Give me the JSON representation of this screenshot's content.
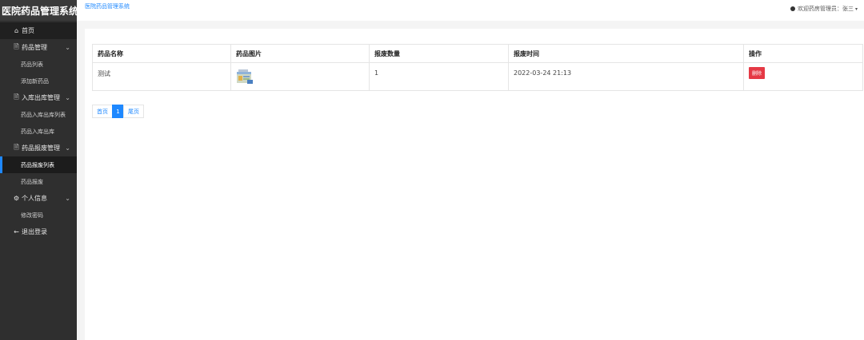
{
  "app": {
    "brand_title": "医院药品管理系统"
  },
  "topbar": {
    "site_link": "医院药品管理系统",
    "user_greeting": "欢迎药房管理员：张三",
    "caret": "▾"
  },
  "sidebar": {
    "home": {
      "icon": "⌂",
      "label": "首页"
    },
    "groups": [
      {
        "icon": "🗎",
        "label": "药品管理",
        "chevron": "⌄",
        "items": [
          "药品列表",
          "添加新药品"
        ]
      },
      {
        "icon": "🗎",
        "label": "入库出库管理",
        "chevron": "⌄",
        "items": [
          "药品入库出库列表",
          "药品入库出库"
        ]
      },
      {
        "icon": "🗎",
        "label": "药品报废管理",
        "chevron": "⌄",
        "items": [
          "药品报废列表",
          "药品报废"
        ]
      },
      {
        "icon": "⚙",
        "label": "个人信息",
        "chevron": "⌄",
        "items": [
          "修改密码"
        ]
      }
    ],
    "logout": {
      "icon": "←",
      "label": "退出登录"
    }
  },
  "table": {
    "headers": [
      "药品名称",
      "药品图片",
      "报废数量",
      "报废时间",
      "操作"
    ],
    "rows": [
      {
        "name": "测试",
        "image_icon": "medicine-box-image",
        "quantity": "1",
        "time": "2022-03-24 21:13",
        "action": "删除"
      }
    ]
  },
  "pagination": {
    "first": "首页",
    "current": "1",
    "last": "尾页"
  },
  "colors": {
    "accent": "#1e88ff",
    "danger": "#e53945",
    "sidebar_bg": "#2f2f2f"
  }
}
